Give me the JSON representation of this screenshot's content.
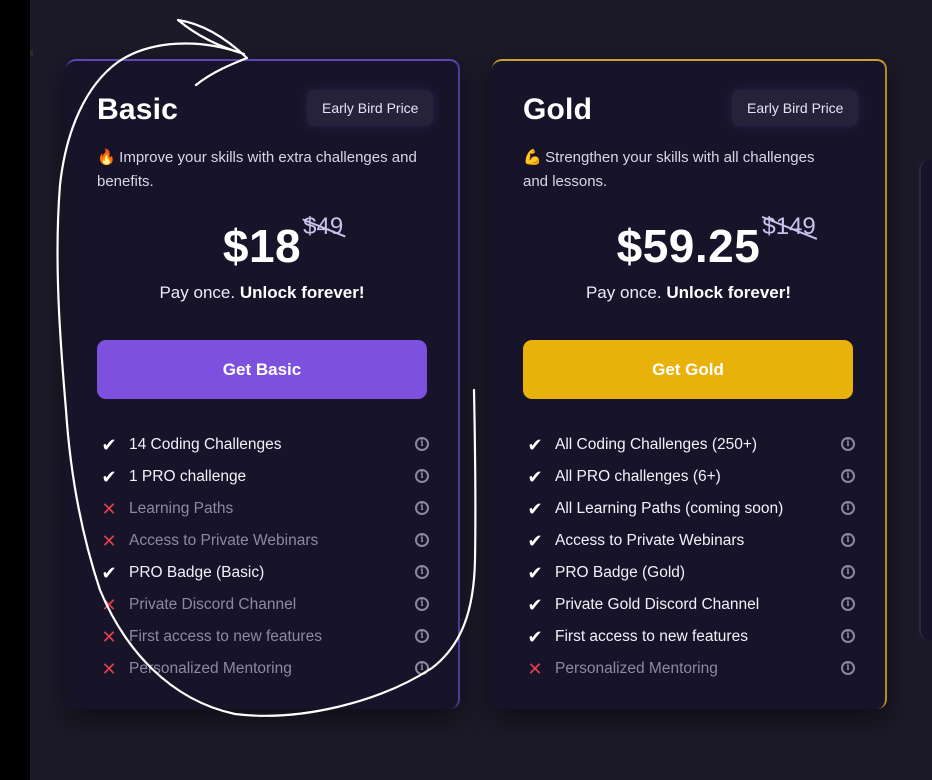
{
  "plans": [
    {
      "name": "Basic",
      "badge": "Early Bird Price",
      "emoji": "🔥",
      "description": "Improve your skills with extra challenges and benefits.",
      "price": "$18",
      "old_price": "$49",
      "pay_once_prefix": "Pay once.",
      "pay_once_bold": "Unlock forever!",
      "cta": "Get Basic",
      "accent_color": "#7d51de",
      "features": [
        {
          "label": "14 Coding Challenges",
          "included": true
        },
        {
          "label": "1 PRO challenge",
          "included": true
        },
        {
          "label": "Learning Paths",
          "included": false
        },
        {
          "label": "Access to Private Webinars",
          "included": false
        },
        {
          "label": "PRO Badge (Basic)",
          "included": true
        },
        {
          "label": "Private Discord Channel",
          "included": false
        },
        {
          "label": "First access to new features",
          "included": false
        },
        {
          "label": "Personalized Mentoring",
          "included": false
        }
      ]
    },
    {
      "name": "Gold",
      "badge": "Early Bird Price",
      "emoji": "💪",
      "description": "Strengthen your skills with all challenges and lessons.",
      "price": "$59.25",
      "old_price": "$149",
      "pay_once_prefix": "Pay once.",
      "pay_once_bold": "Unlock forever!",
      "cta": "Get Gold",
      "accent_color": "#e9b10b",
      "features": [
        {
          "label": "All Coding Challenges (250+)",
          "included": true
        },
        {
          "label": "All PRO challenges (6+)",
          "included": true
        },
        {
          "label": "All Learning Paths (coming soon)",
          "included": true
        },
        {
          "label": "Access to Private Webinars",
          "included": true
        },
        {
          "label": "PRO Badge (Gold)",
          "included": true
        },
        {
          "label": "Private Gold Discord Channel",
          "included": true
        },
        {
          "label": "First access to new features",
          "included": true
        },
        {
          "label": "Personalized Mentoring",
          "included": false
        }
      ]
    }
  ],
  "icons": {
    "included": "check-icon",
    "excluded": "cross-icon",
    "info": "info-icon"
  },
  "colors": {
    "page_background": "#1c1928",
    "card_background": "#17142a",
    "excluded_mark": "#e0404a"
  }
}
